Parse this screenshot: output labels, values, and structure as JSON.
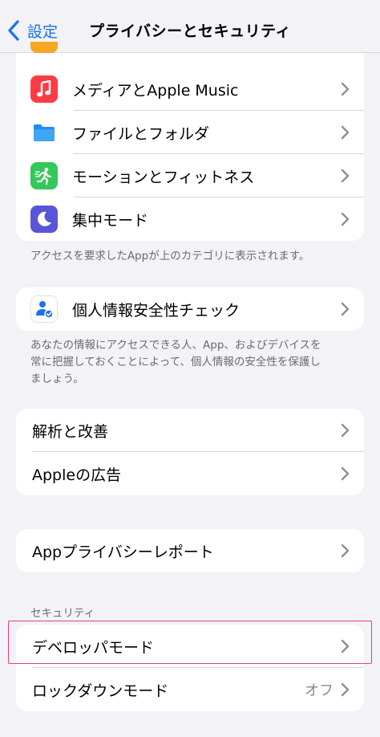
{
  "nav": {
    "back_label": "設定",
    "title": "プライバシーとセキュリティ"
  },
  "group_apps": {
    "items": [
      {
        "label": "メディアとApple Music",
        "icon": "music-note-icon",
        "color": "#fc3c44"
      },
      {
        "label": "ファイルとフォルダ",
        "icon": "folder-icon",
        "color": "#1e8ef0"
      },
      {
        "label": "モーションとフィットネス",
        "icon": "running-figure-icon",
        "color": "#34c759"
      },
      {
        "label": "集中モード",
        "icon": "moon-icon",
        "color": "#5856d6"
      }
    ],
    "footer": "アクセスを要求したAppが上のカテゴリに表示されます。"
  },
  "group_safety": {
    "label": "個人情報安全性チェック",
    "icon": "person-checkmark-icon",
    "footer_lines": [
      "あなたの情報にアクセスできる人、App、およびデバイスを",
      "常に把握しておくことによって、個人情報の安全性を保護し",
      "ましょう。"
    ]
  },
  "group_analytics": {
    "items": [
      {
        "label": "解析と改善"
      },
      {
        "label": "Appleの広告"
      }
    ]
  },
  "group_report": {
    "label": "Appプライバシーレポート"
  },
  "security": {
    "header": "セキュリティ",
    "items": [
      {
        "label": "デベロッパモード",
        "value": ""
      },
      {
        "label": "ロックダウンモード",
        "value": "オフ"
      }
    ]
  },
  "colors": {
    "accent": "#1a73e8",
    "highlight": "#e6407a",
    "background": "#f2f2f7"
  }
}
